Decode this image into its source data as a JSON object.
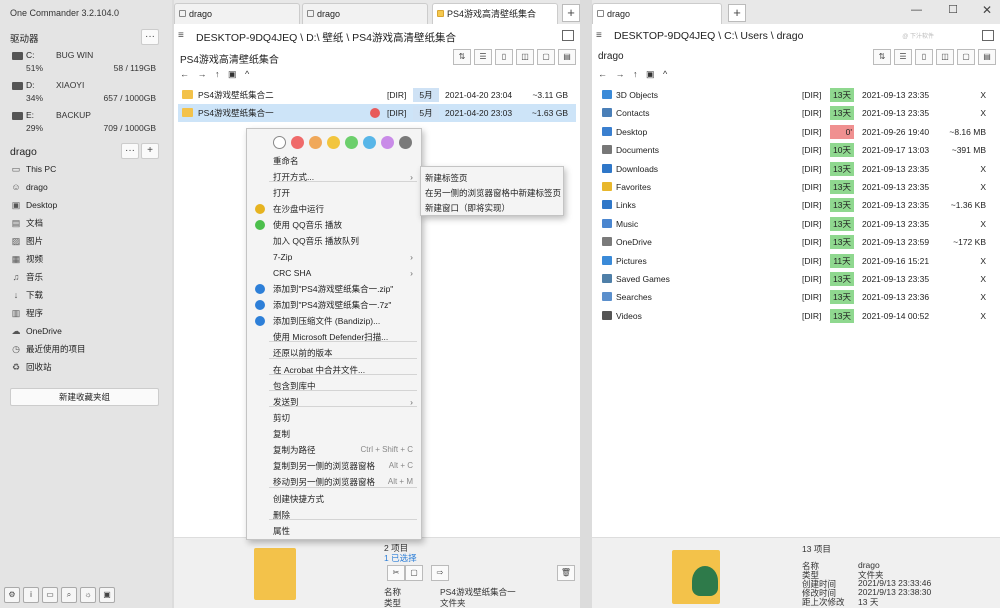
{
  "app": {
    "title": "One Commander 3.2.104.0"
  },
  "sidebar": {
    "drives_header": "驱动器",
    "more_label": "···",
    "drives": [
      {
        "letter": "C:",
        "label": "BUG WIN",
        "percent": "51%",
        "size": "58 / 119GB"
      },
      {
        "letter": "D:",
        "label": "XIAOYI",
        "percent": "34%",
        "size": "657 / 1000GB"
      },
      {
        "letter": "E:",
        "label": "BACKUP",
        "percent": "29%",
        "size": "709 / 1000GB"
      }
    ],
    "favorites_header": "drago",
    "plus_label": "+",
    "favorites": [
      {
        "label": "This PC",
        "icon": "computer-icon"
      },
      {
        "label": "drago",
        "icon": "user-icon"
      },
      {
        "label": "Desktop",
        "icon": "desktop-icon"
      },
      {
        "label": "文档",
        "icon": "document-icon"
      },
      {
        "label": "图片",
        "icon": "picture-icon"
      },
      {
        "label": "视频",
        "icon": "video-icon"
      },
      {
        "label": "音乐",
        "icon": "music-icon"
      },
      {
        "label": "下载",
        "icon": "download-icon"
      },
      {
        "label": "程序",
        "icon": "program-icon"
      },
      {
        "label": "OneDrive",
        "icon": "cloud-icon"
      },
      {
        "label": "最近使用的项目",
        "icon": "clock-icon"
      },
      {
        "label": "回收站",
        "icon": "recycle-icon"
      }
    ],
    "new_group_label": "新建收藏夹组"
  },
  "left_pane": {
    "tabs": [
      {
        "label": "drago"
      },
      {
        "label": "drago"
      },
      {
        "label": "PS4游戏高清壁纸集合"
      }
    ],
    "path": "DESKTOP-9DQ4JEQ \\ D:\\ 壁纸 \\ PS4游戏高清壁纸集合",
    "folder_title": "PS4游戏高清壁纸集合",
    "nav": "← → ↑ ▣ ^",
    "rows": [
      {
        "name": "PS4游戏壁纸集合二",
        "type": "[DIR]",
        "age": "5月",
        "date": "2021-04-20  23:04",
        "size": "~3.11 GB"
      },
      {
        "name": "PS4游戏壁纸集合一",
        "type": "[DIR]",
        "age": "5月",
        "date": "2021-04-20  23:03",
        "size": "~1.63 GB"
      }
    ],
    "details": {
      "count": "2 项目",
      "selected": "1 已选择",
      "name_label": "名称",
      "name_value": "PS4游戏壁纸集合一",
      "type_label": "类型",
      "type_value": "文件夹"
    }
  },
  "right_pane": {
    "tabs": [
      {
        "label": "drago"
      }
    ],
    "path": "DESKTOP-9DQ4JEQ \\ C:\\ Users \\ drago",
    "folder_title": "drago",
    "nav": "← → ↑ ▣ ^",
    "watermark": "@ 下汁软件",
    "rows": [
      {
        "name": "3D Objects",
        "type": "[DIR]",
        "age": "13天",
        "date": "2021-09-13  23:35",
        "size": "X",
        "color": "#3b8ad8",
        "agecolor": "green"
      },
      {
        "name": "Contacts",
        "type": "[DIR]",
        "age": "13天",
        "date": "2021-09-13  23:35",
        "size": "X",
        "color": "#4a7fb8",
        "agecolor": "green"
      },
      {
        "name": "Desktop",
        "type": "[DIR]",
        "age": "0'",
        "date": "2021-09-26  19:40",
        "size": "~8.16 MB",
        "color": "#3a7fcf",
        "agecolor": "red"
      },
      {
        "name": "Documents",
        "type": "[DIR]",
        "age": "10天",
        "date": "2021-09-17  13:03",
        "size": "~391 MB",
        "color": "#777777",
        "agecolor": "green"
      },
      {
        "name": "Downloads",
        "type": "[DIR]",
        "age": "13天",
        "date": "2021-09-13  23:35",
        "size": "X",
        "color": "#2f77c8",
        "agecolor": "green"
      },
      {
        "name": "Favorites",
        "type": "[DIR]",
        "age": "13天",
        "date": "2021-09-13  23:35",
        "size": "X",
        "color": "#e8b72c",
        "agecolor": "green"
      },
      {
        "name": "Links",
        "type": "[DIR]",
        "age": "13天",
        "date": "2021-09-13  23:35",
        "size": "~1.36 KB",
        "color": "#2f77c8",
        "agecolor": "green"
      },
      {
        "name": "Music",
        "type": "[DIR]",
        "age": "13天",
        "date": "2021-09-13  23:35",
        "size": "X",
        "color": "#4a86d0",
        "agecolor": "green"
      },
      {
        "name": "OneDrive",
        "type": "[DIR]",
        "age": "13天",
        "date": "2021-09-13  23:59",
        "size": "~172 KB",
        "color": "#7a7a7a",
        "agecolor": "green"
      },
      {
        "name": "Pictures",
        "type": "[DIR]",
        "age": "11天",
        "date": "2021-09-16  15:21",
        "size": "X",
        "color": "#3a8ad8",
        "agecolor": "green"
      },
      {
        "name": "Saved Games",
        "type": "[DIR]",
        "age": "13天",
        "date": "2021-09-13  23:35",
        "size": "X",
        "color": "#4f7fa8",
        "agecolor": "green"
      },
      {
        "name": "Searches",
        "type": "[DIR]",
        "age": "13天",
        "date": "2021-09-13  23:36",
        "size": "X",
        "color": "#5b8fcc",
        "agecolor": "green"
      },
      {
        "name": "Videos",
        "type": "[DIR]",
        "age": "13天",
        "date": "2021-09-14  00:52",
        "size": "X",
        "color": "#555555",
        "agecolor": "green"
      }
    ],
    "details": {
      "count": "13 项目",
      "name_label": "名称",
      "name_value": "drago",
      "type_label": "类型",
      "type_value": "文件夹",
      "created_label": "创建时间",
      "created_value": "2021/9/13 23:33:46",
      "modified_label": "修改时间",
      "modified_value": "2021/9/13 23:38:30",
      "age_label": "距上次修改",
      "age_value": "13 天"
    }
  },
  "context_menu": {
    "color_tags": [
      "#ffffff",
      "#ef6a6a",
      "#f0a85a",
      "#f2c53d",
      "#6ccf6c",
      "#58b6e8",
      "#c98be8",
      "#7a7a7a"
    ],
    "items": [
      {
        "label": "重命名",
        "shortcut": "",
        "arrow": ""
      },
      {
        "label": "打开方式...",
        "shortcut": "",
        "arrow": "›"
      },
      {
        "label": "打开",
        "shortcut": "",
        "arrow": ""
      },
      {
        "label": "在沙盘中运行",
        "shortcut": "",
        "arrow": "",
        "icon_color": "#e6b320"
      },
      {
        "label": "使用 QQ音乐 播放",
        "shortcut": "",
        "arrow": "",
        "icon_color": "#4cbf4c"
      },
      {
        "label": "加入 QQ音乐 播放队列",
        "shortcut": "",
        "arrow": ""
      },
      {
        "label": "7-Zip",
        "shortcut": "",
        "arrow": "›"
      },
      {
        "label": "CRC SHA",
        "shortcut": "",
        "arrow": "›"
      },
      {
        "label": "添加到\"PS4游戏壁纸集合一.zip\"",
        "shortcut": "",
        "arrow": "",
        "icon_color": "#2d7fd8"
      },
      {
        "label": "添加到\"PS4游戏壁纸集合一.7z\"",
        "shortcut": "",
        "arrow": "",
        "icon_color": "#2d7fd8"
      },
      {
        "label": "添加到压缩文件 (Bandizip)...",
        "shortcut": "",
        "arrow": "",
        "icon_color": "#2d7fd8"
      },
      {
        "label": "使用 Microsoft Defender扫描...",
        "shortcut": "",
        "arrow": ""
      },
      {
        "label": "还原以前的版本",
        "shortcut": "",
        "arrow": ""
      },
      {
        "label": "在 Acrobat 中合并文件...",
        "shortcut": "",
        "arrow": ""
      },
      {
        "label": "包含到库中",
        "shortcut": "",
        "arrow": ""
      },
      {
        "label": "发送到",
        "shortcut": "",
        "arrow": "›"
      },
      {
        "label": "剪切",
        "shortcut": "",
        "arrow": ""
      },
      {
        "label": "复制",
        "shortcut": "",
        "arrow": ""
      },
      {
        "label": "复制为路径",
        "shortcut": "Ctrl + Shift + C",
        "arrow": ""
      },
      {
        "label": "复制到另一侧的浏览器窗格",
        "shortcut": "Alt + C",
        "arrow": ""
      },
      {
        "label": "移动到另一侧的浏览器窗格",
        "shortcut": "Alt + M",
        "arrow": ""
      },
      {
        "label": "创建快捷方式",
        "shortcut": "",
        "arrow": ""
      },
      {
        "label": "删除",
        "shortcut": "",
        "arrow": ""
      },
      {
        "label": "属性",
        "shortcut": "",
        "arrow": ""
      }
    ]
  },
  "submenu": {
    "items": [
      "新建标签页",
      "在另一侧的浏览器窗格中新建标签页",
      "新建窗口（即将实现）"
    ]
  }
}
